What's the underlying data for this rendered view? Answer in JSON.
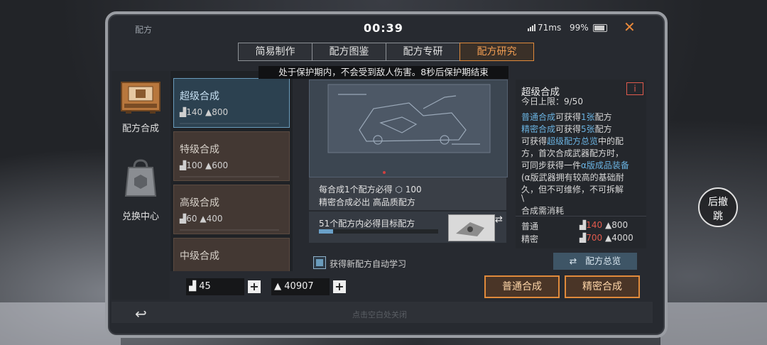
{
  "header": {
    "title": "配方",
    "timer": "00:39",
    "ping": "71ms",
    "battery": "99%",
    "close_icon": "close-icon"
  },
  "tabs": [
    {
      "label": "简易制作",
      "active": false
    },
    {
      "label": "配方图鉴",
      "active": false
    },
    {
      "label": "配方专研",
      "active": false
    },
    {
      "label": "配方研究",
      "active": true
    }
  ],
  "notice": "处于保护期内，不会受到敌人伤害。8秒后保护期结束",
  "sidebar": {
    "items": [
      {
        "label": "配方合成",
        "icon": "synth-machine-icon"
      },
      {
        "label": "兑换中心",
        "icon": "shop-bag-icon"
      }
    ]
  },
  "recipes": [
    {
      "name": "超级合成",
      "cost_a": "140",
      "cost_b": "800",
      "selected": true
    },
    {
      "name": "特级合成",
      "cost_a": "100",
      "cost_b": "600",
      "selected": false
    },
    {
      "name": "高级合成",
      "cost_a": "60",
      "cost_b": "400",
      "selected": false
    },
    {
      "name": "中级合成",
      "cost_a": "",
      "cost_b": "",
      "selected": false
    }
  ],
  "center": {
    "guarantee_line1_prefix": "每合成1个配方必得",
    "guarantee_line1_value": "100",
    "guarantee_line2": "精密合成必出 高品质配方",
    "target_text": "51个配方内必得目标配方",
    "target_progress": 0.12
  },
  "description": {
    "title": "超级合成",
    "daily_limit": "今日上限：9/50",
    "info_icon": "i",
    "line1_a": "普通合成",
    "line1_b": "可获得",
    "line1_c": "1张",
    "line1_d": "配方",
    "line2_a": "精密合成",
    "line2_b": "可获得",
    "line2_c": "5张",
    "line2_d": "配方",
    "line3_a": "可获得",
    "line3_b": "超级配方总览",
    "line3_c": "中的配",
    "line4": "方，首次合成武器配方时，",
    "line5_a": "可同步获得一件",
    "line5_b": "α版成品装备",
    "line6": "(α版武器拥有较高的基础耐",
    "line7": "久，但不可维修，不可拆解",
    "line8": "\\",
    "consume_title": "合成需消耗",
    "normal_label": "普通",
    "normal_a": "140",
    "normal_b": "800",
    "precise_label": "精密",
    "precise_a": "700",
    "precise_b": "4000"
  },
  "auto_learn_label": "获得新配方自动学习",
  "overview_button": "配方总览",
  "resources": {
    "a": "45",
    "b": "40907"
  },
  "buttons": {
    "normal": "普通合成",
    "precise": "精密合成"
  },
  "footer_hint": "点击空白处关闭",
  "float_button": {
    "line1": "后撤",
    "line2": "跳"
  },
  "colors": {
    "accent": "#e08a3b",
    "selected": "#6a9cbc",
    "warn": "#e05a4d"
  }
}
